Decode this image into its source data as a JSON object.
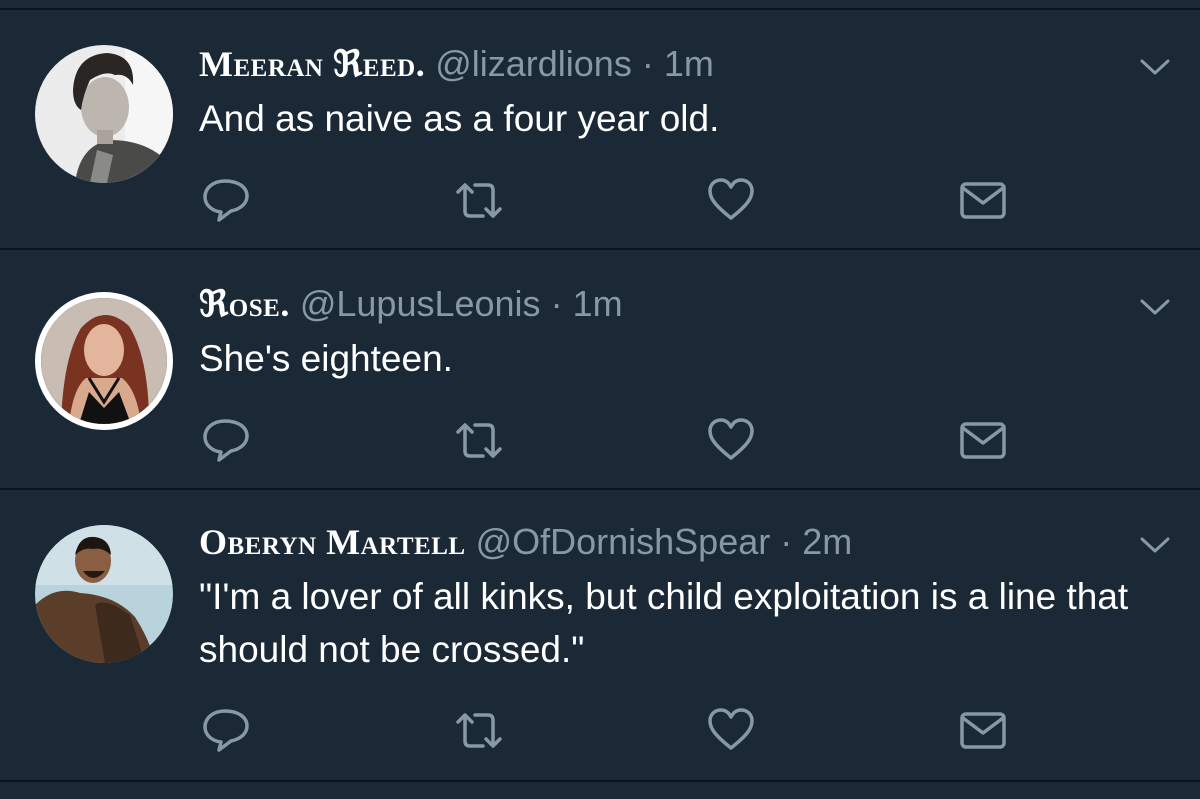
{
  "tweets": [
    {
      "display_name": "Meeran ℜeed.",
      "handle": "@lizardlions",
      "separator": "·",
      "time": "1m",
      "text": "And as naive as a four year old."
    },
    {
      "display_name": "ℜose.",
      "handle": "@LupusLeonis",
      "separator": "·",
      "time": "1m",
      "text": "She's eighteen."
    },
    {
      "display_name": "Oberyn Martell",
      "handle": "@OfDornishSpear",
      "separator": "·",
      "time": "2m",
      "text": "\"I'm a lover of all kinks, but child exploitation is a line that should not be crossed.\""
    }
  ],
  "icons": {
    "reply": "reply-icon",
    "retweet": "retweet-icon",
    "like": "heart-icon",
    "dm": "envelope-icon",
    "more": "chevron-down-icon"
  },
  "colors": {
    "background": "#1b2836",
    "divider": "#0e141b",
    "secondary_text": "#8899a6",
    "primary_text": "#ffffff"
  }
}
